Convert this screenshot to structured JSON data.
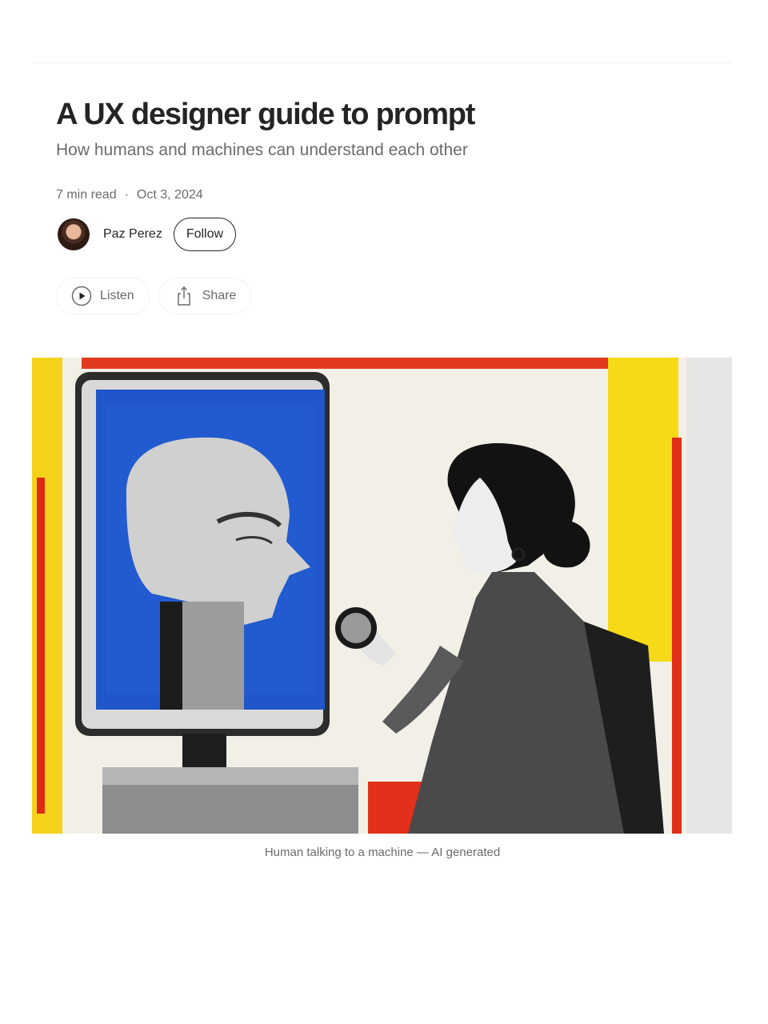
{
  "article": {
    "title": "A UX designer guide to prompt",
    "subtitle": "How humans and machines can understand each other",
    "read_time": "7 min read",
    "separator": "·",
    "date": "Oct 3, 2024"
  },
  "author": {
    "name": "Paz Perez",
    "follow_label": "Follow"
  },
  "actions": {
    "listen_label": "Listen",
    "share_label": "Share"
  },
  "hero": {
    "caption": "Human talking to a machine — AI generated"
  },
  "icons": {
    "listen": "play-circle-icon",
    "share": "share-icon"
  },
  "colors": {
    "text": "#242424",
    "muted": "#6b6b6b",
    "border": "#f2f2f2"
  }
}
